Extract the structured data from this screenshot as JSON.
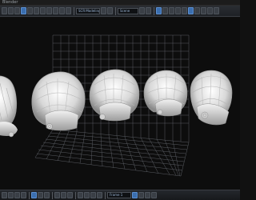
{
  "window": {
    "title": "Blender"
  },
  "toolbar": {
    "fields": [
      "SCR:Modeling",
      "Scene"
    ]
  },
  "statusbar": {
    "fields": [
      "Frame 1"
    ]
  },
  "colors": {
    "background": "#0d0d0d",
    "grid": "#5a5d63",
    "toolbar_accent": "#3b6fb0"
  },
  "icons": [
    "menu-icon",
    "view-icon",
    "select-icon",
    "object-mode-icon",
    "shading-icon",
    "snap-icon",
    "render-icon",
    "layer-icon"
  ]
}
